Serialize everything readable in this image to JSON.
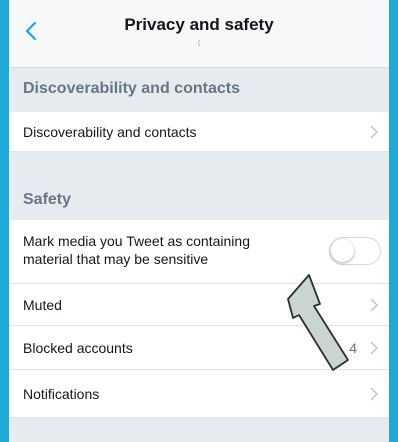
{
  "header": {
    "title": "Privacy and safety",
    "subtitle": "(",
    "back_icon": "chevron-left-icon"
  },
  "sections": {
    "discoverability": {
      "title": "Discoverability and contacts",
      "row_label": "Discoverability and contacts"
    },
    "safety": {
      "title": "Safety",
      "sensitive_media": {
        "line1": "Mark media you Tweet as containing",
        "line2": "material that may be sensitive",
        "toggle_on": false
      },
      "muted": "Muted",
      "blocked": {
        "label": "Blocked accounts",
        "count": "4"
      },
      "notifications": "Notifications"
    }
  },
  "colors": {
    "frame": "#1fa9d8",
    "accent": "#1da1f2",
    "section_text": "#657786",
    "annotation_arrow": "#c9d4d3"
  }
}
